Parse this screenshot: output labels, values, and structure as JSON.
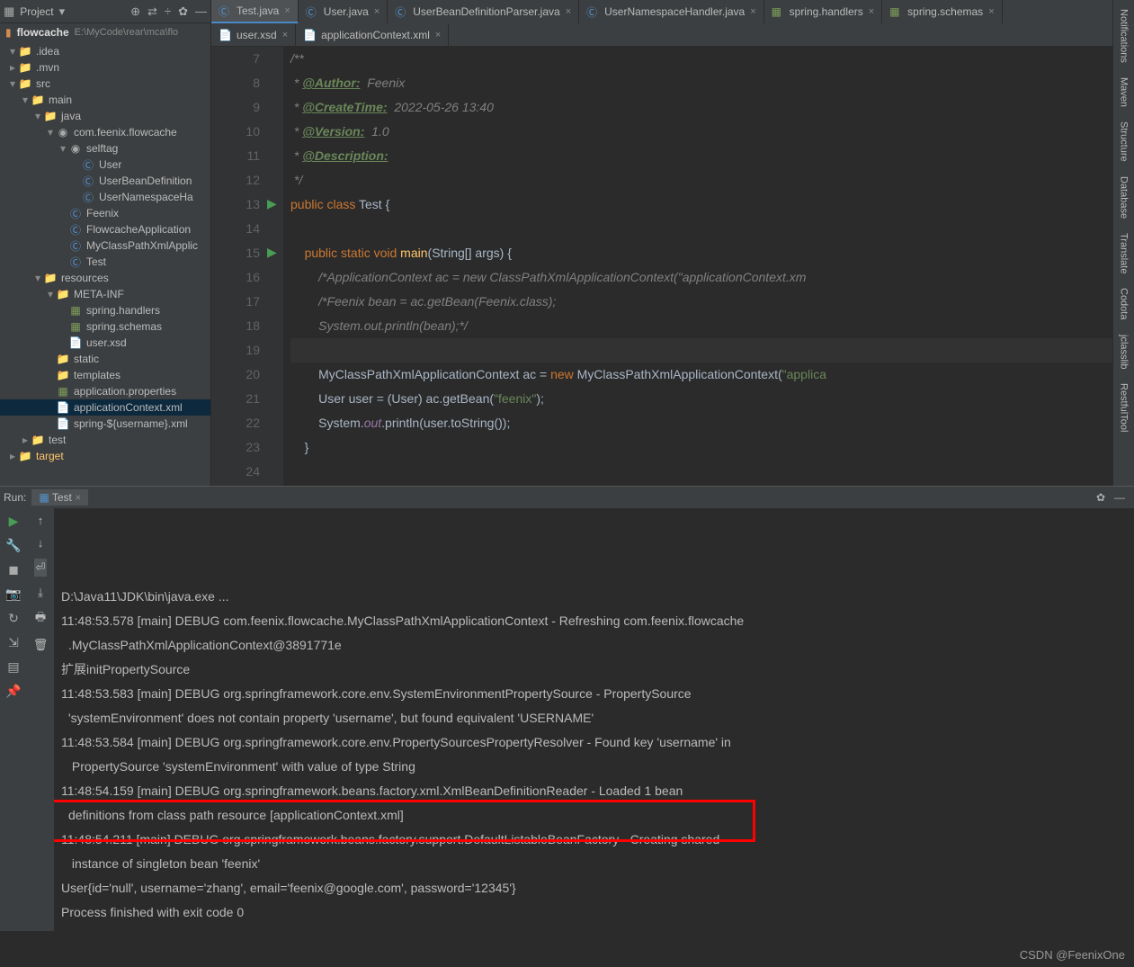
{
  "projectPanel": {
    "title": "Project",
    "rootName": "flowcache",
    "rootPath": "E:\\MyCode\\rear\\mca\\flo"
  },
  "tree": [
    {
      "depth": 0,
      "arrow": "▾",
      "icon": "folder",
      "label": ".idea"
    },
    {
      "depth": 0,
      "arrow": "▸",
      "icon": "folder",
      "label": ".mvn"
    },
    {
      "depth": 0,
      "arrow": "▾",
      "icon": "folder-blue",
      "label": "src"
    },
    {
      "depth": 1,
      "arrow": "▾",
      "icon": "folder-blue",
      "label": "main"
    },
    {
      "depth": 2,
      "arrow": "▾",
      "icon": "folder-blue",
      "label": "java"
    },
    {
      "depth": 3,
      "arrow": "▾",
      "icon": "package",
      "label": "com.feenix.flowcache"
    },
    {
      "depth": 4,
      "arrow": "▾",
      "icon": "package",
      "label": "selftag"
    },
    {
      "depth": 5,
      "arrow": "",
      "icon": "class",
      "label": "User"
    },
    {
      "depth": 5,
      "arrow": "",
      "icon": "class",
      "label": "UserBeanDefinition"
    },
    {
      "depth": 5,
      "arrow": "",
      "icon": "class",
      "label": "UserNamespaceHa"
    },
    {
      "depth": 4,
      "arrow": "",
      "icon": "class",
      "label": "Feenix"
    },
    {
      "depth": 4,
      "arrow": "",
      "icon": "class",
      "label": "FlowcacheApplication"
    },
    {
      "depth": 4,
      "arrow": "",
      "icon": "class",
      "label": "MyClassPathXmlApplic"
    },
    {
      "depth": 4,
      "arrow": "",
      "icon": "class",
      "label": "Test"
    },
    {
      "depth": 2,
      "arrow": "▾",
      "icon": "folder-res",
      "label": "resources"
    },
    {
      "depth": 3,
      "arrow": "▾",
      "icon": "folder",
      "label": "META-INF"
    },
    {
      "depth": 4,
      "arrow": "",
      "icon": "prop",
      "label": "spring.handlers"
    },
    {
      "depth": 4,
      "arrow": "",
      "icon": "prop",
      "label": "spring.schemas"
    },
    {
      "depth": 4,
      "arrow": "",
      "icon": "xml",
      "label": "user.xsd"
    },
    {
      "depth": 3,
      "arrow": "",
      "icon": "folder",
      "label": "static"
    },
    {
      "depth": 3,
      "arrow": "",
      "icon": "folder",
      "label": "templates"
    },
    {
      "depth": 3,
      "arrow": "",
      "icon": "prop",
      "label": "application.properties"
    },
    {
      "depth": 3,
      "arrow": "",
      "icon": "xml",
      "label": "applicationContext.xml",
      "selected": true
    },
    {
      "depth": 3,
      "arrow": "",
      "icon": "xml",
      "label": "spring-${username}.xml"
    },
    {
      "depth": 1,
      "arrow": "▸",
      "icon": "folder-blue",
      "label": "test"
    },
    {
      "depth": 0,
      "arrow": "▸",
      "icon": "folder-target",
      "label": "target",
      "highlighted": true
    }
  ],
  "tabs1": [
    {
      "icon": "class",
      "label": "Test.java",
      "active": true,
      "close": true
    },
    {
      "icon": "class",
      "label": "User.java",
      "close": true
    },
    {
      "icon": "class",
      "label": "UserBeanDefinitionParser.java",
      "close": true
    },
    {
      "icon": "class",
      "label": "UserNamespaceHandler.java",
      "close": true
    },
    {
      "icon": "prop",
      "label": "spring.handlers",
      "close": true
    },
    {
      "icon": "prop",
      "label": "spring.schemas",
      "close": true
    }
  ],
  "tabs2": [
    {
      "icon": "xml",
      "label": "user.xsd",
      "close": true
    },
    {
      "icon": "xml",
      "label": "applicationContext.xml",
      "close": true
    }
  ],
  "code": {
    "startLine": 7,
    "lines": [
      {
        "n": 7,
        "html": "<span class='cmt'>/**</span>"
      },
      {
        "n": 8,
        "html": "<span class='cmt'> * </span><span class='tag'>@Author:</span><span class='auth'>  Feenix</span>"
      },
      {
        "n": 9,
        "html": "<span class='cmt'> * </span><span class='tag'>@CreateTime:</span><span class='auth'>  2022-05-26 13:40</span>"
      },
      {
        "n": 10,
        "html": "<span class='cmt'> * </span><span class='tag'>@Version:</span><span class='auth'>  1.0</span>"
      },
      {
        "n": 11,
        "html": "<span class='cmt'> * </span><span class='tag'>@Description:</span>"
      },
      {
        "n": 12,
        "html": "<span class='cmt'> */</span>"
      },
      {
        "n": 13,
        "run": true,
        "html": "<span class='kw'>public class </span><span class='cls'>Test {</span>"
      },
      {
        "n": 14,
        "html": ""
      },
      {
        "n": 15,
        "run": true,
        "html": "    <span class='kw'>public static void </span><span class='fn'>main</span><span class='cls'>(String[] args) {</span>"
      },
      {
        "n": 16,
        "html": "        <span class='cmt'>/*ApplicationContext ac = new ClassPathXmlApplicationContext(\"applicationContext.xm</span>"
      },
      {
        "n": 17,
        "html": "        <span class='cmt'>/*Feenix bean = ac.getBean(Feenix.class);</span>"
      },
      {
        "n": 18,
        "html": "        <span class='cmt'>System.out.println(bean);*/</span>"
      },
      {
        "n": 19,
        "hl": true,
        "html": ""
      },
      {
        "n": 20,
        "html": "        <span class='cls'>MyClassPathXmlApplicationContext ac = </span><span class='kw'>new </span><span class='cls'>MyClassPathXmlApplicationContext(</span><span class='str'>\"applica</span>"
      },
      {
        "n": 21,
        "html": "        <span class='cls'>User user = (User) ac.getBean(</span><span class='str'>\"feenix\"</span><span class='cls'>);</span>"
      },
      {
        "n": 22,
        "html": "        <span class='cls'>System.</span><span class='out'>out</span><span class='cls'>.println(user.toString());</span>"
      },
      {
        "n": 23,
        "html": "    <span class='cls'>}</span>"
      },
      {
        "n": 24,
        "html": ""
      }
    ]
  },
  "run": {
    "headerLabel": "Run:",
    "tabLabel": "Test"
  },
  "console": [
    "D:\\Java11\\JDK\\bin\\java.exe ...",
    "11:48:53.578 [main] DEBUG com.feenix.flowcache.MyClassPathXmlApplicationContext - Refreshing com.feenix.flowcache",
    ".MyClassPathXmlApplicationContext@3891771e",
    "扩展initPropertySource",
    "11:48:53.583 [main] DEBUG org.springframework.core.env.SystemEnvironmentPropertySource - PropertySource ",
    "'systemEnvironment' does not contain property 'username', but found equivalent 'USERNAME'",
    "11:48:53.584 [main] DEBUG org.springframework.core.env.PropertySourcesPropertyResolver - Found key 'username' in",
    " PropertySource 'systemEnvironment' with value of type String",
    "11:48:54.159 [main] DEBUG org.springframework.beans.factory.xml.XmlBeanDefinitionReader - Loaded 1 bean ",
    "definitions from class path resource [applicationContext.xml]",
    "11:48:54.211 [main] DEBUG org.springframework.beans.factory.support.DefaultListableBeanFactory - Creating shared",
    " instance of singleton bean 'feenix'",
    "User{id='null', username='zhang', email='feenix@google.com', password='12345'}",
    "",
    "Process finished with exit code 0"
  ],
  "rightTabs": [
    "Notifications",
    "Maven",
    "Structure",
    "Database",
    "Translate",
    "Codota",
    "jclasslib",
    "RestfulTool"
  ],
  "watermark": "CSDN @FeenixOne"
}
